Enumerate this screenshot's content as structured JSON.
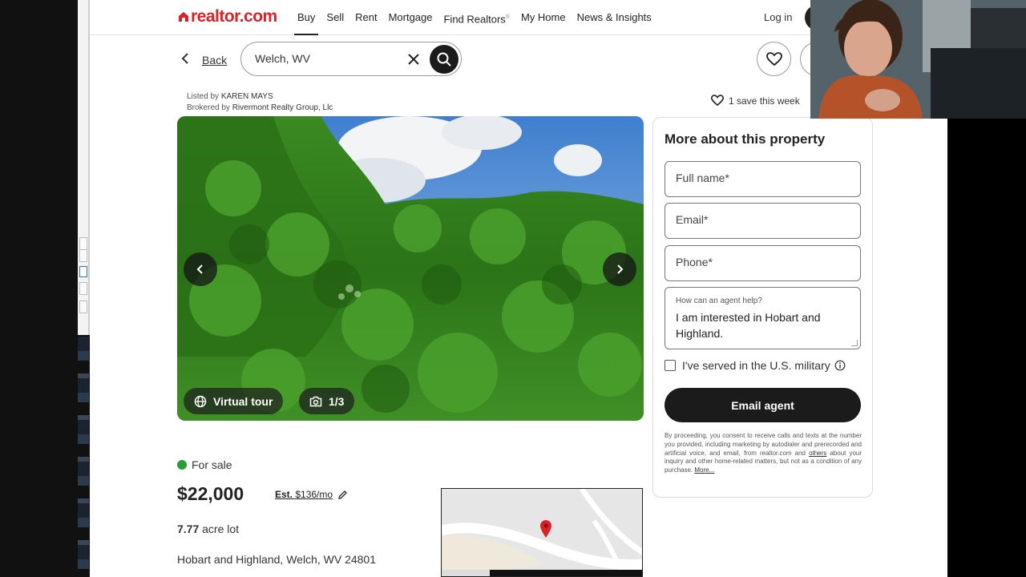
{
  "nav": {
    "logo": "realtor.com",
    "items": [
      "Buy",
      "Sell",
      "Rent",
      "Mortgage",
      "Find Realtors",
      "My Home",
      "News & Insights"
    ],
    "active": "Buy",
    "login": "Log in"
  },
  "search": {
    "back_label": "Back",
    "value": "Welch, WV"
  },
  "listing": {
    "listed_by_prefix": "Listed by",
    "listed_by": "KAREN MAYS",
    "brokered_by_prefix": "Brokered by",
    "brokered_by": "Rivermont Realty Group, Llc",
    "saves": "1 save this week"
  },
  "photo": {
    "virtual_tour": "Virtual tour",
    "count": "1/3"
  },
  "form": {
    "title": "More about this property",
    "full_name_placeholder": "Full name*",
    "email_placeholder": "Email*",
    "phone_placeholder": "Phone*",
    "message_label": "How can an agent help?",
    "message_text": "I am interested in Hobart and Highland.",
    "military_label": "I've served in the U.S. military",
    "military_checked": false,
    "submit": "Email agent",
    "disclaimer_1": "By proceeding, you consent to receive calls and texts at the number you provided, including marketing by autodialer and prerecorded and artificial voice, and email, from realtor.com and ",
    "disclaimer_link": "others",
    "disclaimer_2": " about your inquiry and other home-related matters, but not as a condition of any purchase. ",
    "disclaimer_more": "More..."
  },
  "summary": {
    "status": "For sale",
    "price": "$22,000",
    "est_prefix": "Est.",
    "est_value": "$136/mo",
    "lot_size": "7.77",
    "lot_unit": "acre lot",
    "address": "Hobart and Highland, Welch, WV 24801"
  },
  "colors": {
    "brand_red": "#d92228",
    "status_green": "#2a9d3a",
    "button_dark": "#1b1b1b"
  },
  "icons": [
    "logo-house-icon",
    "chevron-left-icon",
    "close-icon",
    "search-icon",
    "heart-icon",
    "globe-icon",
    "camera-icon",
    "chevron-right-icon",
    "info-icon",
    "pencil-icon",
    "map-pin-icon"
  ]
}
